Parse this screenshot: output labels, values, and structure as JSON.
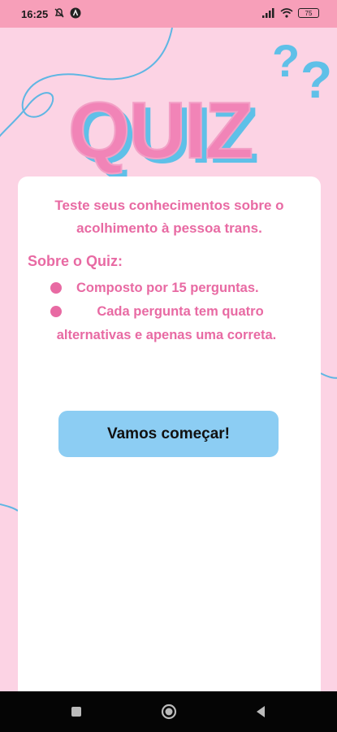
{
  "status": {
    "time": "16:25",
    "battery": "75"
  },
  "header": {
    "title": "QUIZ"
  },
  "card": {
    "intro_line1": "Teste seus conhecimentos sobre o",
    "intro_line2": "acolhimento à pessoa trans.",
    "about_title": "Sobre o Quiz:",
    "bullets": [
      "Composto por 15 perguntas.",
      "Cada pergunta tem quatro alternativas e apenas uma correta."
    ],
    "start_label": "Vamos começar!"
  },
  "colors": {
    "background": "#fcd3e4",
    "accent_pink": "#e86aa3",
    "accent_blue": "#8ccdf3",
    "status_bar": "#f79fb9"
  }
}
